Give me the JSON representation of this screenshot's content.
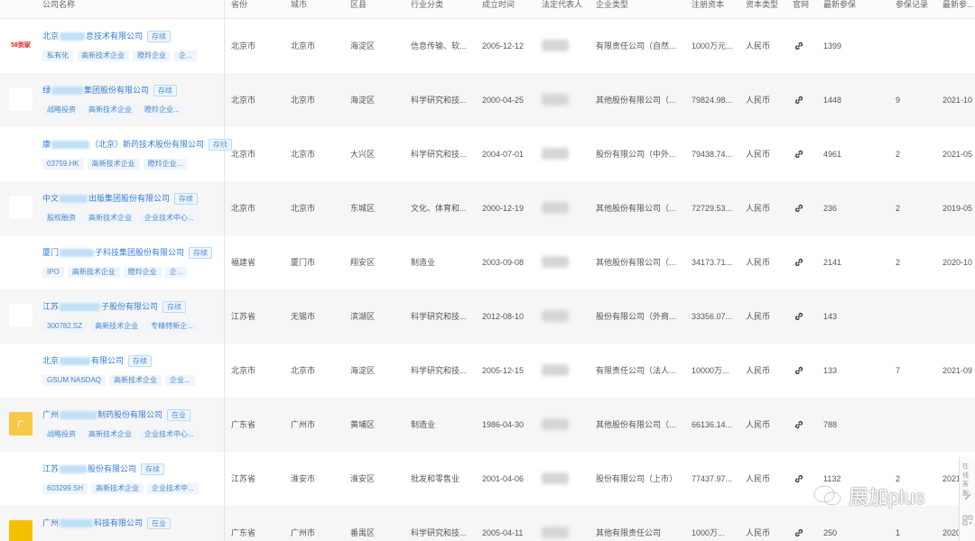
{
  "columns": {
    "company": "公司名称",
    "province": "省份",
    "city": "城市",
    "district": "区县",
    "industry": "行业分类",
    "founded": "成立时间",
    "legal_rep": "法定代表人",
    "company_type": "企业类型",
    "capital": "注册资本",
    "capital_type": "资本类型",
    "website": "官网",
    "insured": "最新参保",
    "insured_records": "参保记录",
    "insured_latest": "最新参..."
  },
  "rows": [
    {
      "logo_text": "58到家",
      "logo_color": "#e02020",
      "logo_bg": "#ffffff",
      "name_a": "北京",
      "name_b": "息技术有限公司",
      "name_c": "",
      "status": "存续",
      "tags": [
        "私有化",
        "高新技术企业",
        "瞪羚企业",
        "企..."
      ],
      "province": "北京市",
      "city": "北京市",
      "district": "海淀区",
      "industry": "信息传输、软...",
      "founded": "2005-12-12",
      "company_type": "有限责任公司（自然...",
      "capital": "1000万元...",
      "capital_type": "人民币",
      "insured": "1399",
      "records": "",
      "latest": ""
    },
    {
      "logo_text": "",
      "logo_color": "#3a8a3a",
      "logo_bg": "#ffffff",
      "name_a": "绿",
      "name_b": "集团股份有限公司",
      "name_c": "",
      "status": "存续",
      "tags": [
        "战略投资",
        "高新技术企业",
        "瞪羚企业..."
      ],
      "province": "北京市",
      "city": "北京市",
      "district": "海淀区",
      "industry": "科学研究和技...",
      "founded": "2000-04-25",
      "company_type": "其他股份有限公司（...",
      "capital": "79824.98...",
      "capital_type": "人民币",
      "insured": "1448",
      "records": "9",
      "latest": "2021-10"
    },
    {
      "logo_text": "",
      "logo_color": "#c02020",
      "logo_bg": "#ffffff",
      "name_a": "康",
      "name_b": "（北京）新药技术股份有限公司",
      "name_c": "",
      "status": "存续",
      "tags": [
        "03759.HK",
        "高新技术企业",
        "瞪羚企业..."
      ],
      "province": "北京市",
      "city": "北京市",
      "district": "大兴区",
      "industry": "科学研究和技...",
      "founded": "2004-07-01",
      "company_type": "股份有限公司（中外...",
      "capital": "79438.74...",
      "capital_type": "人民币",
      "insured": "4961",
      "records": "2",
      "latest": "2021-05"
    },
    {
      "logo_text": "",
      "logo_color": "#e06a10",
      "logo_bg": "#ffffff",
      "name_a": "中文",
      "name_b": "出版集团股份有限公司",
      "name_c": "",
      "status": "存续",
      "tags": [
        "股权融资",
        "高新技术企业",
        "企业技术中心..."
      ],
      "province": "北京市",
      "city": "北京市",
      "district": "东城区",
      "industry": "文化、体育和...",
      "founded": "2000-12-19",
      "company_type": "其他股份有限公司（...",
      "capital": "72729.53...",
      "capital_type": "人民币",
      "insured": "236",
      "records": "2",
      "latest": "2019-05"
    },
    {
      "logo_text": "",
      "logo_color": "#d04040",
      "logo_bg": "#ffffff",
      "name_a": "厦门",
      "name_b": "子科技集团股份有限公司",
      "name_c": "",
      "status": "存续",
      "tags": [
        "IPO",
        "高新技术企业",
        "瞪羚企业",
        "企..."
      ],
      "province": "福建省",
      "city": "厦门市",
      "district": "翔安区",
      "industry": "制造业",
      "founded": "2003-09-08",
      "company_type": "其他股份有限公司（...",
      "capital": "34173.71...",
      "capital_type": "人民币",
      "insured": "2141",
      "records": "2",
      "latest": "2020-10"
    },
    {
      "logo_text": "",
      "logo_color": "#444444",
      "logo_bg": "#ffffff",
      "name_a": "江苏",
      "name_b": "子股份有限公司",
      "name_c": "",
      "status": "存续",
      "tags": [
        "300782.SZ",
        "高新技术企业",
        "专精特新企..."
      ],
      "province": "江苏省",
      "city": "无锡市",
      "district": "滨湖区",
      "industry": "科学研究和技...",
      "founded": "2012-08-10",
      "company_type": "股份有限公司（外商...",
      "capital": "33356.07...",
      "capital_type": "人民币",
      "insured": "143",
      "records": "",
      "latest": ""
    },
    {
      "logo_text": "",
      "logo_color": "#1a3a7a",
      "logo_bg": "#ffffff",
      "name_a": "北京",
      "name_b": "有限公司",
      "name_c": "",
      "status": "存续",
      "tags": [
        "GSUM NASDAQ",
        "高新技术企业",
        "企业..."
      ],
      "province": "北京市",
      "city": "北京市",
      "district": "海淀区",
      "industry": "科学研究和技...",
      "founded": "2005-12-15",
      "company_type": "有限责任公司（法人...",
      "capital": "10000万...",
      "capital_type": "人民币",
      "insured": "133",
      "records": "7",
      "latest": "2021-09"
    },
    {
      "logo_text": "广",
      "logo_color": "#ffffff",
      "logo_bg": "#f7c948",
      "name_a": "广州",
      "name_b": "制药股份有限公司",
      "name_c": "",
      "status": "在业",
      "tags": [
        "战略投资",
        "高新技术企业",
        "企业技术中心..."
      ],
      "province": "广东省",
      "city": "广州市",
      "district": "黄埔区",
      "industry": "制造业",
      "founded": "1986-04-30",
      "company_type": "其他股份有限公司（...",
      "capital": "66136.14...",
      "capital_type": "人民币",
      "insured": "788",
      "records": "",
      "latest": ""
    },
    {
      "logo_text": "",
      "logo_color": "#2a9a5a",
      "logo_bg": "#ffffff",
      "name_a": "江苏",
      "name_b": "股份有限公司",
      "name_c": "",
      "status": "存续",
      "tags": [
        "603299.SH",
        "高新技术企业",
        "企业技术中..."
      ],
      "province": "江苏省",
      "city": "淮安市",
      "district": "淮安区",
      "industry": "批发和零售业",
      "founded": "2001-04-06",
      "company_type": "股份有限公司（上市）",
      "capital": "77437.97...",
      "capital_type": "人民币",
      "insured": "1132",
      "records": "2",
      "latest": "2021"
    },
    {
      "logo_text": "",
      "logo_color": "#222222",
      "logo_bg": "#f5c000",
      "name_a": "广州",
      "name_b": "科技有限公司",
      "name_c": "",
      "status": "在业",
      "tags": [],
      "province": "广东省",
      "city": "广州市",
      "district": "番禺区",
      "industry": "科学研究和技...",
      "founded": "2005-04-11",
      "company_type": "其他有限责任公司",
      "capital": "1000万...",
      "capital_type": "人民币",
      "insured": "250",
      "records": "1",
      "latest": "2020-0"
    }
  ],
  "watermark": {
    "text": "展加plus"
  },
  "side_panel": {
    "line1": "在线",
    "line2": "客服"
  }
}
